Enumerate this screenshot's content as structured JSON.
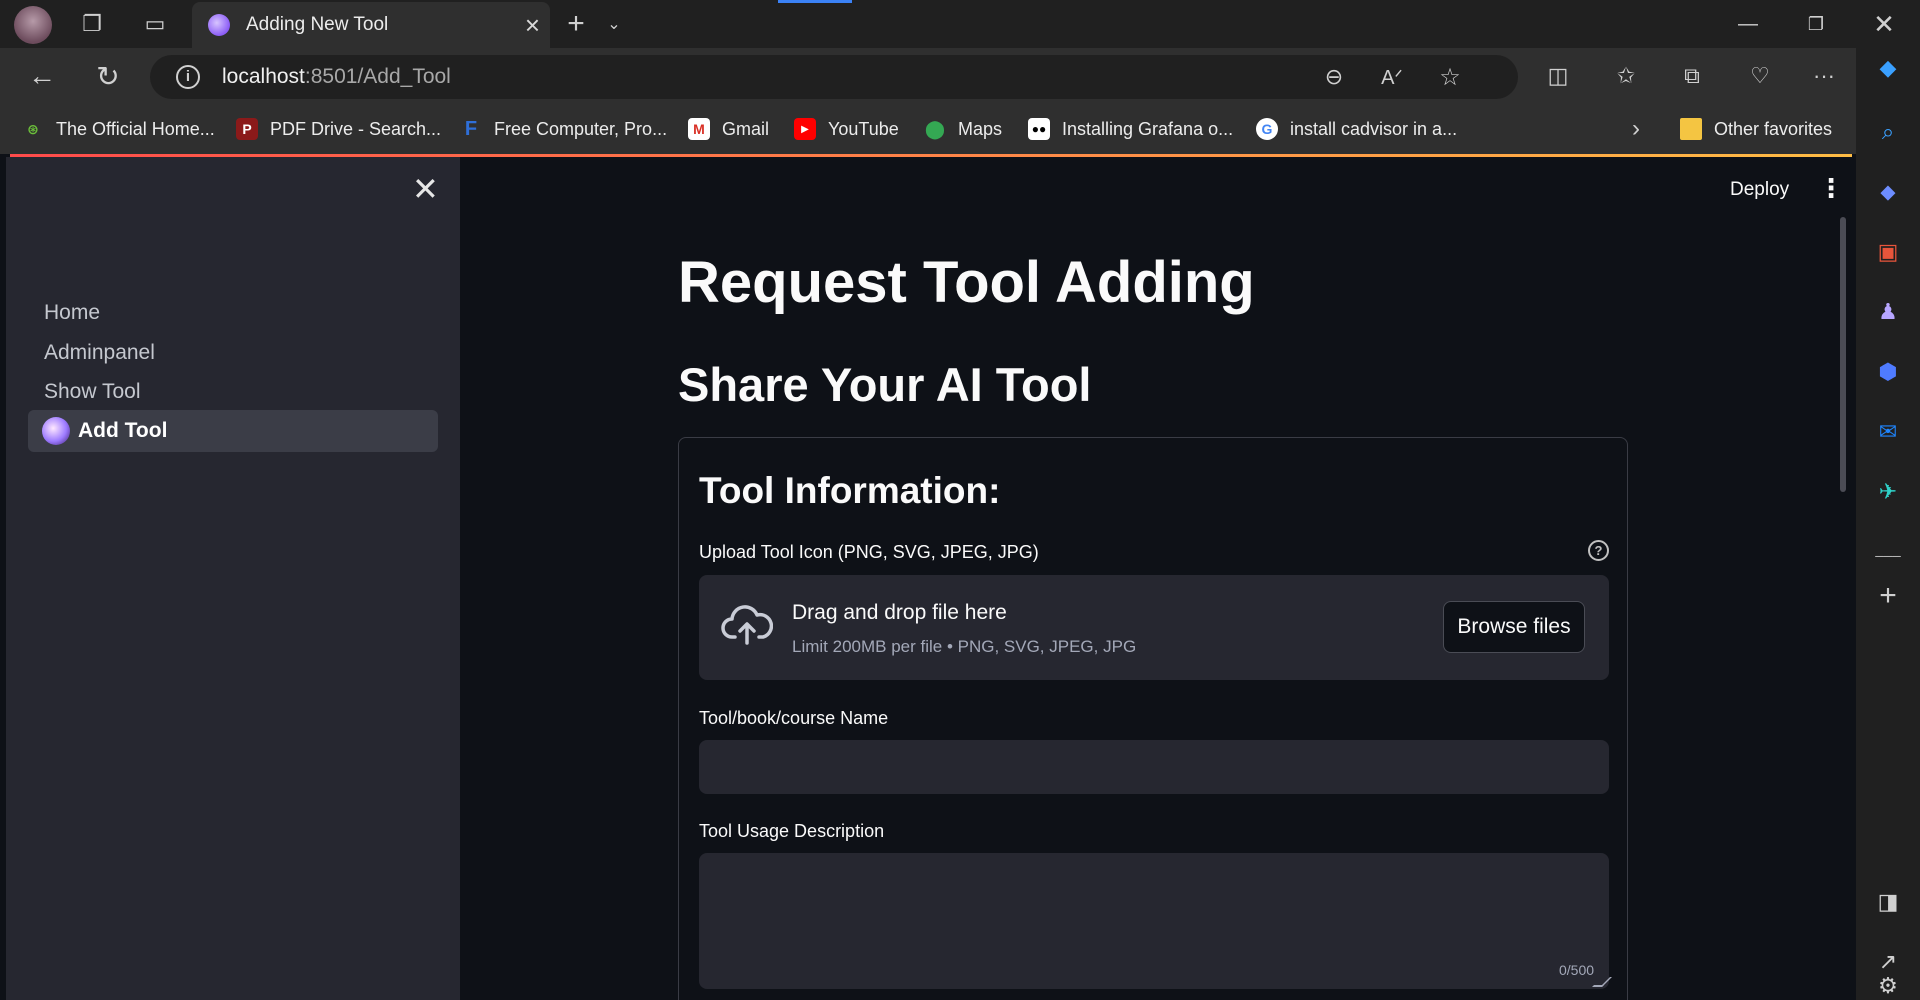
{
  "browser": {
    "tab_title": "Adding New Tool",
    "url_host": "localhost",
    "url_path": ":8501/Add_Tool",
    "accent_color": "#3b82f6"
  },
  "bookmarks": [
    {
      "label": "The Official Home...",
      "icon": "official-home-favicon"
    },
    {
      "label": "PDF Drive - Search...",
      "icon": "pdf-drive-favicon"
    },
    {
      "label": "Free Computer, Pro...",
      "icon": "freecomputer-favicon"
    },
    {
      "label": "Gmail",
      "icon": "gmail-favicon"
    },
    {
      "label": "YouTube",
      "icon": "youtube-favicon"
    },
    {
      "label": "Maps",
      "icon": "maps-favicon"
    },
    {
      "label": "Installing Grafana o...",
      "icon": "medium-favicon"
    },
    {
      "label": "install cadvisor in a...",
      "icon": "google-favicon"
    }
  ],
  "other_favorites": "Other favorites",
  "sidebar": {
    "items": [
      {
        "label": "Home"
      },
      {
        "label": "Adminpanel"
      },
      {
        "label": "Show Tool"
      },
      {
        "label": "Add Tool",
        "active": true
      }
    ]
  },
  "header": {
    "deploy_label": "Deploy"
  },
  "main": {
    "title": "Request Tool Adding",
    "subtitle": "Share Your AI Tool",
    "form": {
      "heading": "Tool Information:",
      "upload_label": "Upload Tool Icon (PNG, SVG, JPEG, JPG)",
      "help_glyph": "?",
      "dropzone_title": "Drag and drop file here",
      "dropzone_limit": "Limit 200MB per file • PNG, SVG, JPEG, JPG",
      "browse_label": "Browse files",
      "name_label": "Tool/book/course Name",
      "name_value": "",
      "desc_label": "Tool Usage Description",
      "desc_value": "",
      "char_count": "0/500"
    }
  }
}
